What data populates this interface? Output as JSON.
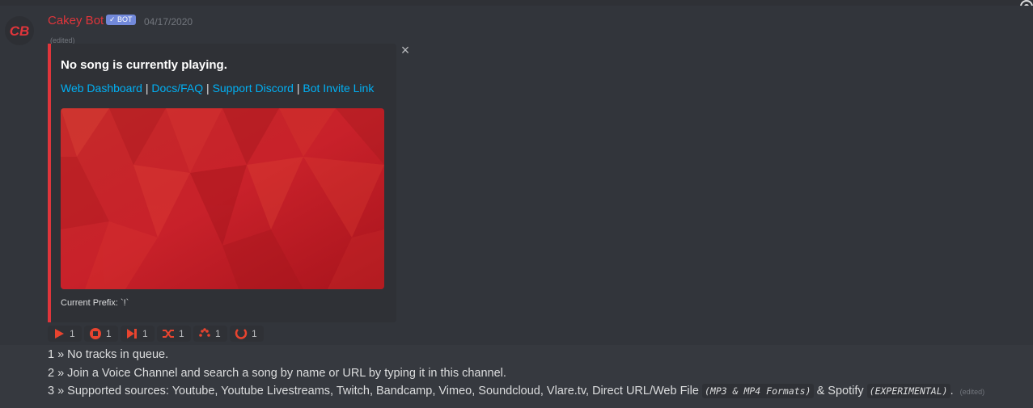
{
  "message": {
    "username": "Cakey Bot",
    "badge": "✓ BOT",
    "timestamp": "04/17/2020",
    "edited_label": "(edited)",
    "avatar_text": "CB"
  },
  "embed": {
    "title": "No song is currently playing.",
    "links": [
      "Web Dashboard",
      "Docs/FAQ",
      "Support Discord",
      "Bot Invite Link"
    ],
    "separator": "|",
    "footer": "Current Prefix: `!`",
    "accent_color": "#e0353b",
    "close_icon": "×"
  },
  "reactions": [
    {
      "icon": "play-icon",
      "count": "1"
    },
    {
      "icon": "stop-icon",
      "count": "1"
    },
    {
      "icon": "skip-icon",
      "count": "1"
    },
    {
      "icon": "shuffle-icon",
      "count": "1"
    },
    {
      "icon": "loading-dots-icon",
      "count": "1"
    },
    {
      "icon": "repeat-icon",
      "count": "1"
    }
  ],
  "content": {
    "line1": "1 » No tracks in queue.",
    "line2": "2 » Join a Voice Channel and search a song by name or URL by typing it in this channel.",
    "line3_prefix": "3 » Supported sources: Youtube, Youtube Livestreams, Twitch, Bandcamp, Vimeo, Soundcloud, Vlare.tv, Direct URL/Web File",
    "line3_code1": "(MP3 & MP4 Formats)",
    "line3_mid": "& Spotify",
    "line3_code2": "(EXPERIMENTAL)",
    "line3_suffix": ".",
    "edited_label": "(edited)"
  }
}
